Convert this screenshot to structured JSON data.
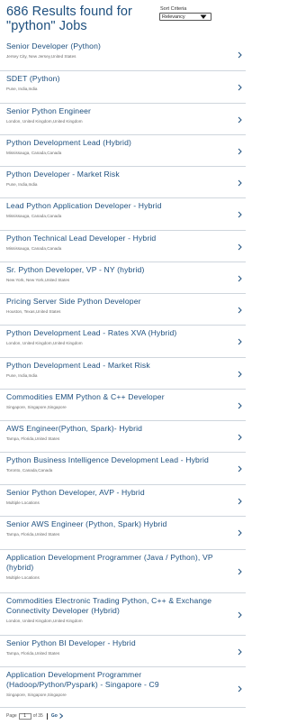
{
  "header": {
    "results_title": "686 Results found for \"python\" Jobs",
    "sort_label": "Sort Criteria",
    "sort_value": "Relevancy"
  },
  "jobs": [
    {
      "title": "Senior Developer (Python)",
      "location": "Jersey City, New Jersey,United States"
    },
    {
      "title": "SDET (Python)",
      "location": "Pune, India,India"
    },
    {
      "title": "Senior Python Engineer",
      "location": "London, United Kingdom,United Kingdom"
    },
    {
      "title": "Python Development Lead (Hybrid)",
      "location": "Mississauga, Canada,Canada"
    },
    {
      "title": "Python Developer - Market Risk",
      "location": "Pune, India,India"
    },
    {
      "title": "Lead Python Application Developer - Hybrid",
      "location": "Mississauga, Canada,Canada"
    },
    {
      "title": "Python Technical Lead Developer - Hybrid",
      "location": "Mississauga, Canada,Canada"
    },
    {
      "title": "Sr. Python Developer, VP - NY (hybrid)",
      "location": "New York, New York,United States"
    },
    {
      "title": "Pricing Server Side Python Developer",
      "location": "Houston, Texas,United States"
    },
    {
      "title": "Python Development Lead - Rates XVA (Hybrid)",
      "location": "London, United Kingdom,United Kingdom"
    },
    {
      "title": "Python Development Lead - Market Risk",
      "location": "Pune, India,India"
    },
    {
      "title": "Commodities EMM Python & C++ Developer",
      "location": "Singapore, Singapore,Singapore"
    },
    {
      "title": "AWS Engineer(Python, Spark)- Hybrid",
      "location": "Tampa, Florida,United States"
    },
    {
      "title": "Python Business Intelligence Development Lead - Hybrid",
      "location": "Toronto, Canada,Canada"
    },
    {
      "title": "Senior Python Developer, AVP - Hybrid",
      "location": "Multiple Locations"
    },
    {
      "title": "Senior AWS Engineer (Python, Spark) Hybrid",
      "location": "Tampa, Florida,United States"
    },
    {
      "title": "Application Development Programmer (Java / Python), VP (hybrid)",
      "location": "Multiple Locations"
    },
    {
      "title": "Commodities Electronic Trading Python, C++ & Exchange Connectivity Developer (Hybrid)",
      "location": "London, United Kingdom,United Kingdom"
    },
    {
      "title": "Senior Python BI Developer - Hybrid",
      "location": "Tampa, Florida,United States"
    },
    {
      "title": "Application Development Programmer (Hadoop/Python/Pyspark) - Singapore - C9",
      "location": "Singapore, Singapore,Singapore"
    }
  ],
  "pager": {
    "page_label": "Page",
    "current_page": "1",
    "of_label": "of 35",
    "go_label": "Go"
  },
  "colors": {
    "accent": "#1d4f7e",
    "divider": "#cfd6dd",
    "location": "#6b6b6b"
  }
}
